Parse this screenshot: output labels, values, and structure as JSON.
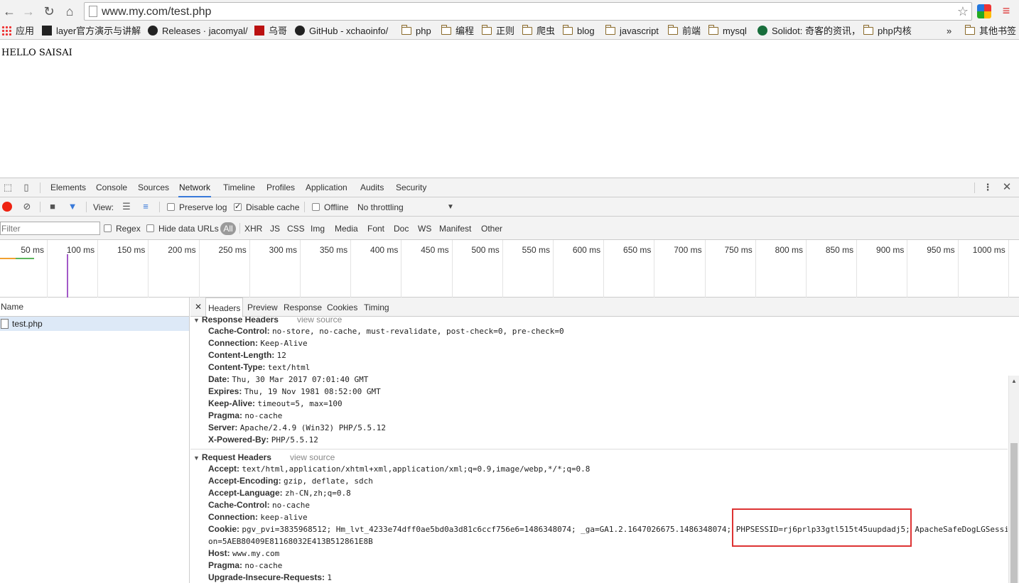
{
  "browser": {
    "url": "www.my.com/test.php",
    "bookmarks": [
      {
        "label": "应用",
        "icon": "apps-grid-icon"
      },
      {
        "label": "layer官方演示与讲解",
        "icon": "layer-icon"
      },
      {
        "label": "Releases · jacomyal/",
        "icon": "github-icon"
      },
      {
        "label": "乌哥",
        "icon": "site-icon"
      },
      {
        "label": "GitHub - xchaoinfo/",
        "icon": "github-icon"
      },
      {
        "label": "php",
        "icon": "folder-icon"
      },
      {
        "label": "编程",
        "icon": "folder-icon"
      },
      {
        "label": "正则",
        "icon": "folder-icon"
      },
      {
        "label": "爬虫",
        "icon": "folder-icon"
      },
      {
        "label": "blog",
        "icon": "folder-icon"
      },
      {
        "label": "javascript",
        "icon": "folder-icon"
      },
      {
        "label": "前端",
        "icon": "folder-icon"
      },
      {
        "label": "mysql",
        "icon": "folder-icon"
      },
      {
        "label": "Solidot: 奇客的资讯，",
        "icon": "solidot-icon"
      },
      {
        "label": "php内核",
        "icon": "folder-icon"
      }
    ],
    "overflow": "»",
    "other_bookmarks": "其他书签"
  },
  "page": {
    "text": "HELLO SAISAI"
  },
  "devtools": {
    "tabs": [
      "Elements",
      "Console",
      "Sources",
      "Network",
      "Timeline",
      "Profiles",
      "Application",
      "Audits",
      "Security"
    ],
    "active_tab": "Network",
    "controls": {
      "view_label": "View:",
      "preserve_log": "Preserve log",
      "disable_cache": "Disable cache",
      "offline": "Offline",
      "throttling": "No throttling"
    },
    "filter": {
      "placeholder": "Filter",
      "regex": "Regex",
      "hide_data_urls": "Hide data URLs",
      "types": [
        "All",
        "XHR",
        "JS",
        "CSS",
        "Img",
        "Media",
        "Font",
        "Doc",
        "WS",
        "Manifest",
        "Other"
      ]
    },
    "timeline_ticks": [
      "50 ms",
      "100 ms",
      "150 ms",
      "200 ms",
      "250 ms",
      "300 ms",
      "350 ms",
      "400 ms",
      "450 ms",
      "500 ms",
      "550 ms",
      "600 ms",
      "650 ms",
      "700 ms",
      "750 ms",
      "800 ms",
      "850 ms",
      "900 ms",
      "950 ms",
      "1000 ms"
    ],
    "requests": {
      "column": "Name",
      "items": [
        "test.php"
      ]
    },
    "detail_tabs": [
      "Headers",
      "Preview",
      "Response",
      "Cookies",
      "Timing"
    ],
    "response_headers": {
      "title": "Response Headers",
      "view_source": "view source",
      "rows": [
        {
          "k": "Cache-Control:",
          "v": "no-store, no-cache, must-revalidate, post-check=0, pre-check=0"
        },
        {
          "k": "Connection:",
          "v": "Keep-Alive"
        },
        {
          "k": "Content-Length:",
          "v": "12"
        },
        {
          "k": "Content-Type:",
          "v": "text/html"
        },
        {
          "k": "Date:",
          "v": "Thu, 30 Mar 2017 07:01:40 GMT"
        },
        {
          "k": "Expires:",
          "v": "Thu, 19 Nov 1981 08:52:00 GMT"
        },
        {
          "k": "Keep-Alive:",
          "v": "timeout=5, max=100"
        },
        {
          "k": "Pragma:",
          "v": "no-cache"
        },
        {
          "k": "Server:",
          "v": "Apache/2.4.9 (Win32) PHP/5.5.12"
        },
        {
          "k": "X-Powered-By:",
          "v": "PHP/5.5.12"
        }
      ]
    },
    "request_headers": {
      "title": "Request Headers",
      "view_source": "view source",
      "rows": [
        {
          "k": "Accept:",
          "v": "text/html,application/xhtml+xml,application/xml;q=0.9,image/webp,*/*;q=0.8"
        },
        {
          "k": "Accept-Encoding:",
          "v": "gzip, deflate, sdch"
        },
        {
          "k": "Accept-Language:",
          "v": "zh-CN,zh;q=0.8"
        },
        {
          "k": "Cache-Control:",
          "v": "no-cache"
        },
        {
          "k": "Connection:",
          "v": "keep-alive"
        },
        {
          "k": "Cookie:",
          "v": "pgv_pvi=3835968512; Hm_lvt_4233e74dff0ae5bd0a3d81c6ccf756e6=1486348074; _ga=GA1.2.1647026675.1486348074; PHPSESSID=rj6prlp33gtl515t45uupdadj5; ApacheSafeDogLGSessi"
        },
        {
          "k": "",
          "v": "on=5AEB80409E81168032E413B512861E8B"
        },
        {
          "k": "Host:",
          "v": "www.my.com"
        },
        {
          "k": "Pragma:",
          "v": "no-cache"
        },
        {
          "k": "Upgrade-Insecure-Requests:",
          "v": "1"
        }
      ]
    }
  }
}
